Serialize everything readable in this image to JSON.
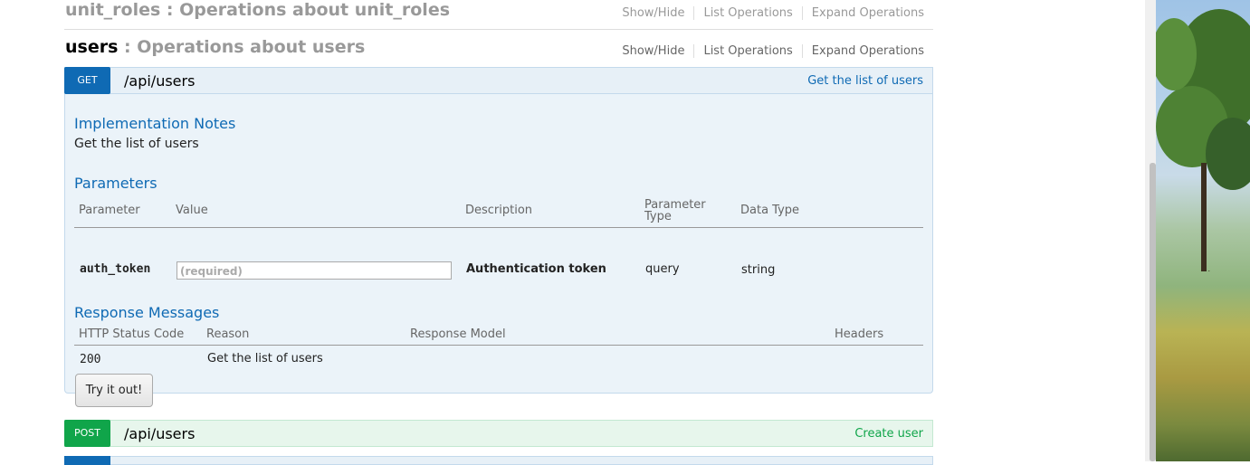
{
  "resources": [
    {
      "name": "unit_roles",
      "desc": " : Operations about unit_roles",
      "links": [
        "Show/Hide",
        "List Operations",
        "Expand Operations"
      ]
    },
    {
      "name": "users",
      "desc": " : Operations about users",
      "links": [
        "Show/Hide",
        "List Operations",
        "Expand Operations"
      ]
    }
  ],
  "get_op": {
    "verb": "GET",
    "path": "/api/users",
    "summary": "Get the list of users",
    "notes_title": "Implementation Notes",
    "notes": "Get the list of users",
    "params_title": "Parameters",
    "param_headers": [
      "Parameter",
      "Value",
      "Description",
      "Parameter Type",
      "Data Type"
    ],
    "param_type_line1": "Parameter",
    "param_type_line2": "Type",
    "param": {
      "name": "auth_token",
      "placeholder": "(required)",
      "description": "Authentication token",
      "type": "query",
      "data_type": "string"
    },
    "responses_title": "Response Messages",
    "response_headers": [
      "HTTP Status Code",
      "Reason",
      "Response Model",
      "Headers"
    ],
    "response": {
      "code": "200",
      "reason": "Get the list of users"
    },
    "try_button": "Try it out!"
  },
  "post_op": {
    "verb": "POST",
    "path": "/api/users",
    "summary": "Create user"
  },
  "colors": {
    "get": "#0f6ab4",
    "post": "#10a54a"
  }
}
